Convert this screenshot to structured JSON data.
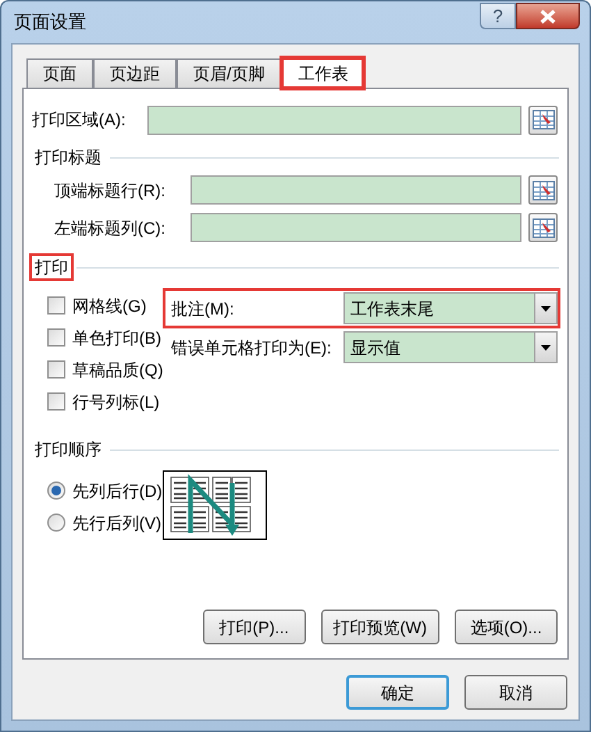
{
  "window": {
    "title": "页面设置",
    "help": "?"
  },
  "tabs": [
    {
      "label": "页面",
      "selected": false,
      "highlighted": false
    },
    {
      "label": "页边距",
      "selected": false,
      "highlighted": false
    },
    {
      "label": "页眉/页脚",
      "selected": false,
      "highlighted": false
    },
    {
      "label": "工作表",
      "selected": true,
      "highlighted": true
    }
  ],
  "print_area": {
    "label": "打印区域(A):"
  },
  "print_titles": {
    "title": "打印标题",
    "fields": [
      {
        "label": "顶端标题行(R):"
      },
      {
        "label": "左端标题列(C):"
      }
    ]
  },
  "print": {
    "title": "打印",
    "highlighted": true,
    "options": [
      {
        "label": "网格线(G)",
        "checked": false
      },
      {
        "label": "单色打印(B)",
        "checked": false
      },
      {
        "label": "草稿品质(Q)",
        "checked": false
      },
      {
        "label": "行号列标(L)",
        "checked": false
      }
    ],
    "selects": [
      {
        "label": "批注(M):",
        "value": "工作表末尾",
        "highlighted": true
      },
      {
        "label": "错误单元格打印为(E):",
        "value": "显示值",
        "highlighted": false
      }
    ]
  },
  "print_order": {
    "title": "打印顺序",
    "options": [
      {
        "label": "先列后行(D)",
        "selected": true
      },
      {
        "label": "先行后列(V)",
        "selected": false
      }
    ]
  },
  "panel_buttons": [
    "打印(P)...",
    "打印预览(W)",
    "选项(O)..."
  ],
  "footer_buttons": [
    {
      "label": "确定",
      "focused": true
    },
    {
      "label": "取消",
      "focused": false
    }
  ]
}
